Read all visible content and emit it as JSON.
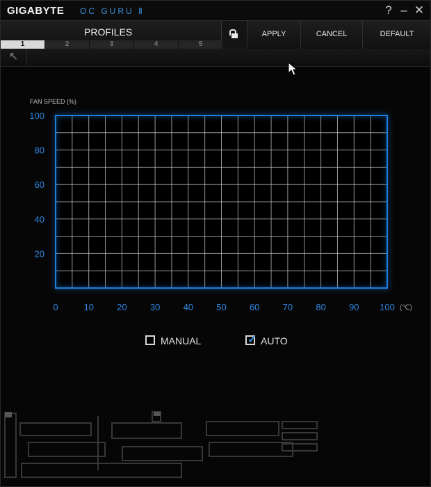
{
  "titlebar": {
    "brand": "GIGABYTE",
    "product": "OC GURU Ⅱ",
    "help_glyph": "?",
    "minimize_glyph": "–",
    "close_glyph": "✕"
  },
  "header": {
    "title": "PROFILES",
    "apply_label": "APPLY",
    "cancel_label": "CANCEL",
    "default_label": "DEFAULT",
    "lock_icon": "lock-open-icon"
  },
  "profile_tabs": [
    "1",
    "2",
    "3",
    "4",
    "5"
  ],
  "active_profile": "1",
  "toolbar": {
    "back_icon": "arrow-up-left-icon",
    "back_glyph": "↖"
  },
  "chart_data": {
    "type": "line",
    "ylabel": "FAN SPEED (%)",
    "xunit": "(℃)",
    "xlim": [
      0,
      100
    ],
    "ylim": [
      0,
      100
    ],
    "x_ticks": [
      0,
      10,
      20,
      30,
      40,
      50,
      60,
      70,
      80,
      90,
      100
    ],
    "y_ticks": [
      20,
      40,
      60,
      80,
      100
    ],
    "grid": true,
    "series": [],
    "grid_color": "#c8c8c8",
    "border_glow_color": "#1e7fe0",
    "tick_color": "#2f86e3"
  },
  "controls": {
    "manual_label": "MANUAL",
    "manual_checked": false,
    "auto_label": "AUTO",
    "auto_checked": true,
    "accent": "#3b8fd9"
  }
}
